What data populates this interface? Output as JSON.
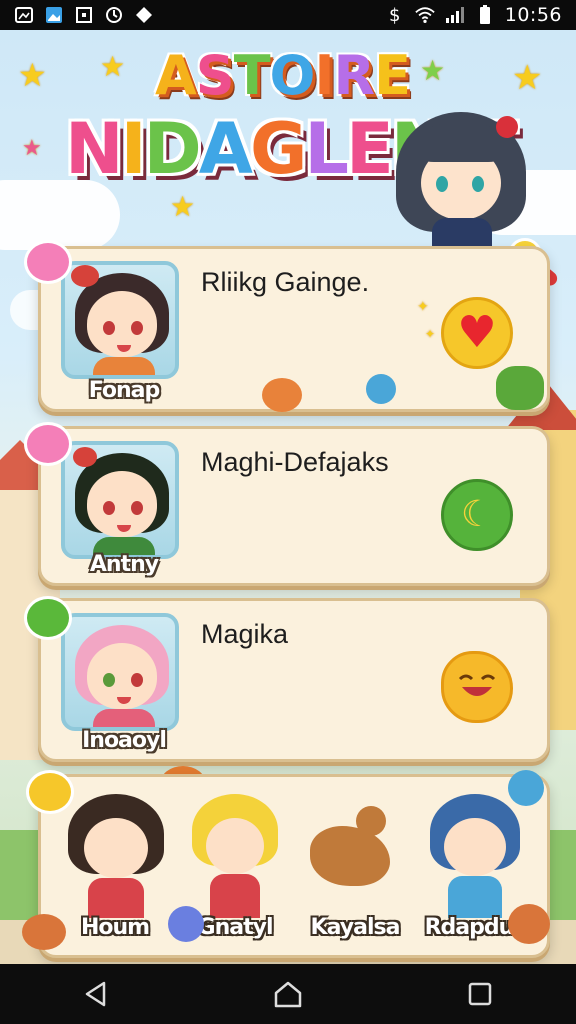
{
  "status_bar": {
    "time": "10:56",
    "left_icons": [
      "gallery-icon",
      "photo-icon",
      "square-icon",
      "refresh-icon",
      "diamond-icon"
    ],
    "right_icons": [
      "dollar-icon",
      "wifi-icon",
      "signal-icon",
      "battery-icon"
    ]
  },
  "game": {
    "title_top": "ASTOIRE",
    "title_main": "NIDAGLENIT",
    "cards": [
      {
        "name": "Fonap",
        "title": "Rliikg Gainge.",
        "action_icon": "heart-icon"
      },
      {
        "name": "Antny",
        "title": "Maghi-Defajaks",
        "action_icon": "banana-icon"
      },
      {
        "name": "Inoaoyl",
        "title": "Magika",
        "action_icon": "smile-face-icon"
      }
    ],
    "roster": [
      {
        "name": "Houm"
      },
      {
        "name": "Gnatyl"
      },
      {
        "name": "Kayalsa"
      },
      {
        "name": "Rdapdus"
      }
    ]
  },
  "nav_bar": {
    "buttons": [
      "back-icon",
      "home-icon",
      "recents-icon"
    ]
  },
  "colors": {
    "card_bg": "#fbf1dd",
    "card_border": "#d9bf90",
    "heart": "#e8262e",
    "action_yellow": "#f6c72a",
    "action_green": "#55b33b"
  }
}
